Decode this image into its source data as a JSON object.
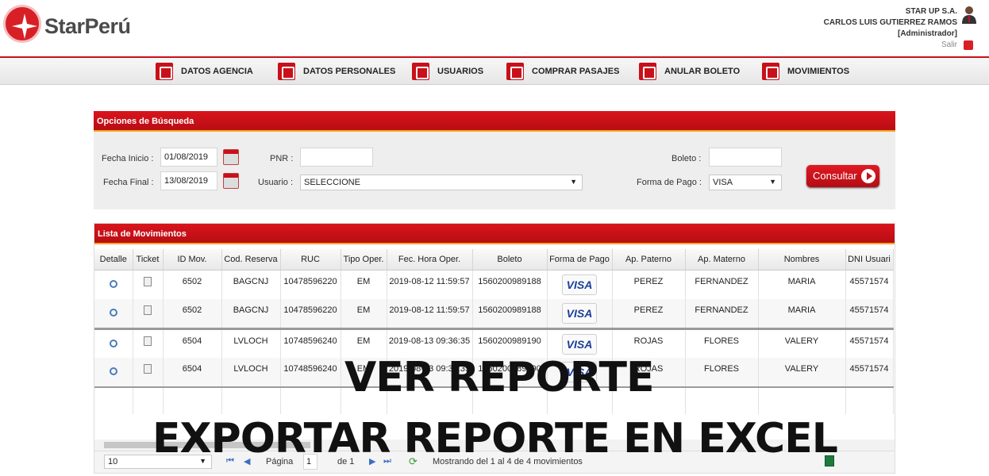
{
  "brand": {
    "logo_text": "StarPerú"
  },
  "user": {
    "company": "STAR UP S.A.",
    "name": "CARLOS LUIS GUTIERREZ RAMOS",
    "role": "[Administrador]",
    "logout": "Salir"
  },
  "nav": [
    {
      "label": "DATOS AGENCIA",
      "icon": "agency-icon"
    },
    {
      "label": "DATOS PERSONALES",
      "icon": "personal-data-icon"
    },
    {
      "label": "USUARIOS",
      "icon": "users-icon"
    },
    {
      "label": "COMPRAR PASAJES",
      "icon": "cart-icon"
    },
    {
      "label": "ANULAR BOLETO",
      "icon": "cancel-ticket-icon"
    },
    {
      "label": "MOVIMIENTOS",
      "icon": "movements-icon"
    }
  ],
  "search": {
    "title": "Opciones de Búsqueda",
    "fecha_inicio_label": "Fecha Inicio :",
    "fecha_inicio": "01/08/2019",
    "fecha_final_label": "Fecha Final :",
    "fecha_final": "13/08/2019",
    "pnr_label": "PNR :",
    "pnr": "",
    "usuario_label": "Usuario :",
    "usuario": "SELECCIONE",
    "boleto_label": "Boleto :",
    "boleto": "",
    "forma_pago_label": "Forma de Pago :",
    "forma_pago": "VISA",
    "consultar": "Consultar"
  },
  "list": {
    "title": "Lista de Movimientos",
    "headers": [
      "Detalle",
      "Ticket",
      "ID Mov.",
      "Cod. Reserva",
      "RUC",
      "Tipo Oper.",
      "Fec. Hora Oper.",
      "Boleto",
      "Forma de Pago",
      "Ap. Paterno",
      "Ap. Materno",
      "Nombres",
      "DNI Usuari"
    ],
    "rows": [
      {
        "id": "6502",
        "reserva": "BAGCNJ",
        "ruc": "10478596220",
        "tipo": "EM",
        "fecha": "2019-08-12 11:59:57",
        "boleto": "1560200989188",
        "pago": "VISA",
        "paterno": "PEREZ",
        "materno": "FERNANDEZ",
        "nombres": "MARIA",
        "dni": "45571574"
      },
      {
        "id": "6502",
        "reserva": "BAGCNJ",
        "ruc": "10478596220",
        "tipo": "EM",
        "fecha": "2019-08-12 11:59:57",
        "boleto": "1560200989188",
        "pago": "VISA",
        "paterno": "PEREZ",
        "materno": "FERNANDEZ",
        "nombres": "MARIA",
        "dni": "45571574"
      },
      {
        "id": "6504",
        "reserva": "LVLOCH",
        "ruc": "10748596240",
        "tipo": "EM",
        "fecha": "2019-08-13 09:36:35",
        "boleto": "1560200989190",
        "pago": "VISA",
        "paterno": "ROJAS",
        "materno": "FLORES",
        "nombres": "VALERY",
        "dni": "45571574"
      },
      {
        "id": "6504",
        "reserva": "LVLOCH",
        "ruc": "10748596240",
        "tipo": "EM",
        "fecha": "2019-08-13 09:36:35",
        "boleto": "1560200989190",
        "pago": "VISA",
        "paterno": "ROJAS",
        "materno": "FLORES",
        "nombres": "VALERY",
        "dni": "45571574"
      }
    ]
  },
  "pager": {
    "page_size": "10",
    "pagina_label": "Página",
    "page": "1",
    "of_label": "de 1",
    "status": "Mostrando del 1 al 4 de 4 movimientos"
  },
  "overlay": {
    "line1": "VER REPORTE",
    "line2": "EXPORTAR REPORTE EN EXCEL"
  }
}
